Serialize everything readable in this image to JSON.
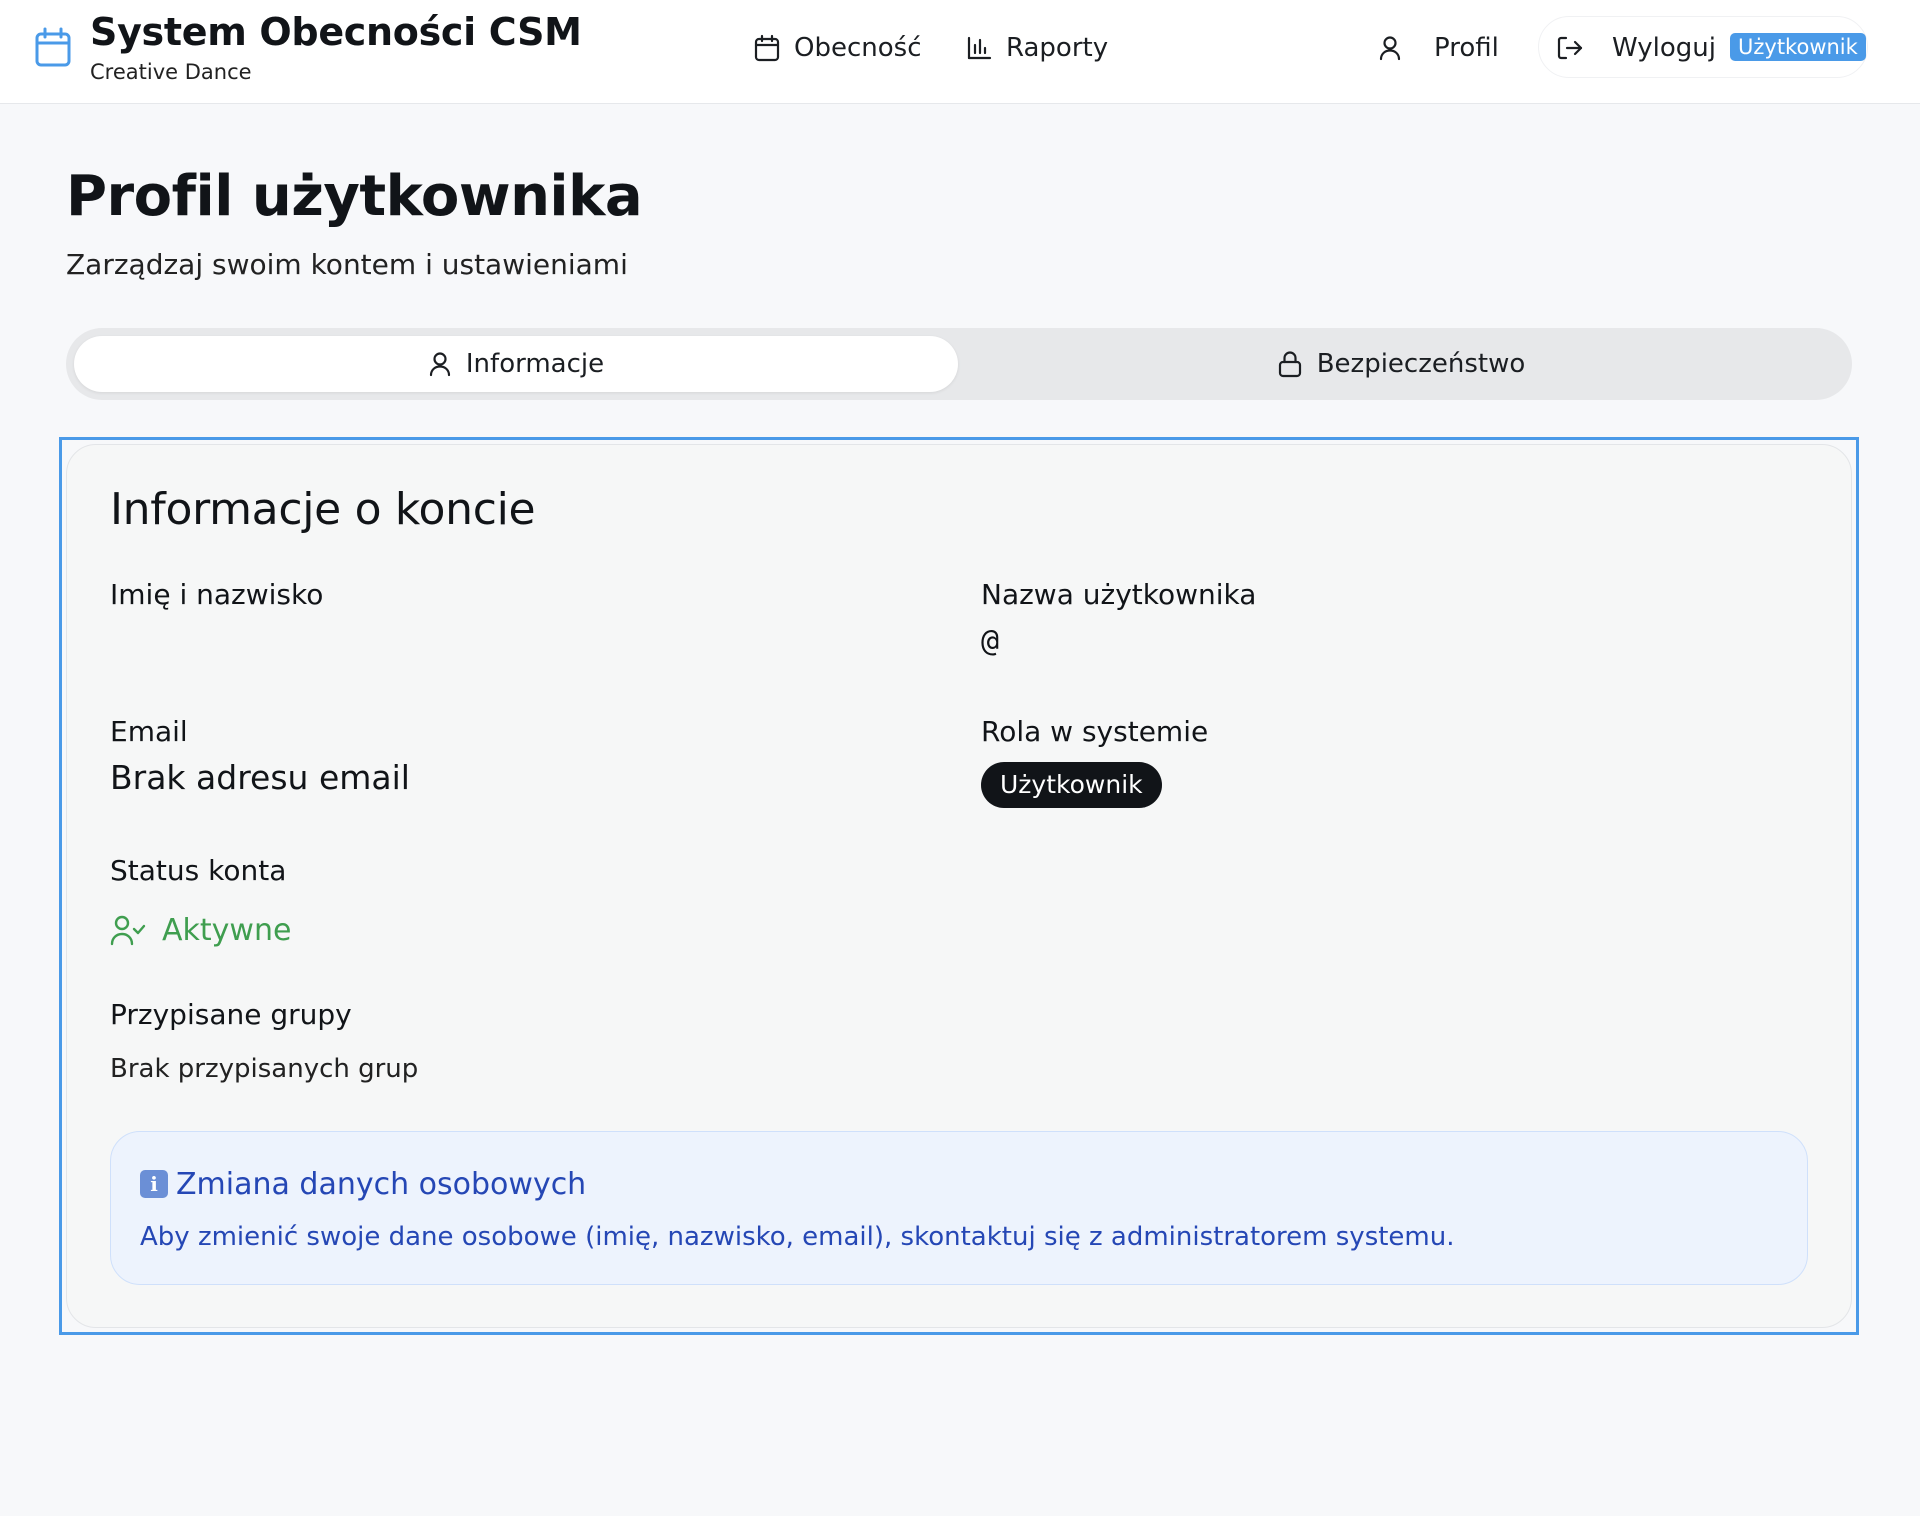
{
  "app": {
    "title": "System Obecności CSM",
    "subtitle": "Creative Dance"
  },
  "nav": {
    "attendance": "Obecność",
    "reports": "Raporty",
    "profile": "Profil",
    "logout": "Wyloguj",
    "role_tag": "Użytkownik"
  },
  "page": {
    "title": "Profil użytkownika",
    "subtitle": "Zarządzaj swoim kontem i ustawieniami"
  },
  "tabs": [
    {
      "label": "Informacje",
      "icon": "user-icon",
      "active": true
    },
    {
      "label": "Bezpieczeństwo",
      "icon": "lock-icon",
      "active": false
    }
  ],
  "account": {
    "title": "Informacje o koncie",
    "fullname_label": "Imię i nazwisko",
    "fullname_value": "",
    "username_label": "Nazwa użytkownika",
    "username_value": "@",
    "email_label": "Email",
    "email_value": "Brak adresu email",
    "role_label": "Rola w systemie",
    "role_value": "Użytkownik",
    "status_label": "Status konta",
    "status_value": "Aktywne",
    "groups_label": "Przypisane grupy",
    "groups_value": "Brak przypisanych grup"
  },
  "notice": {
    "icon": "info-icon",
    "title": "Zmiana danych osobowych",
    "text": "Aby zmienić swoje dane osobowe (imię, nazwisko, email), skontaktuj się z administratorem systemu."
  },
  "colors": {
    "accent": "#4a9ae8",
    "active_green": "#3f9e4f",
    "notice_blue": "#2547b5",
    "badge_dark": "#111418"
  }
}
